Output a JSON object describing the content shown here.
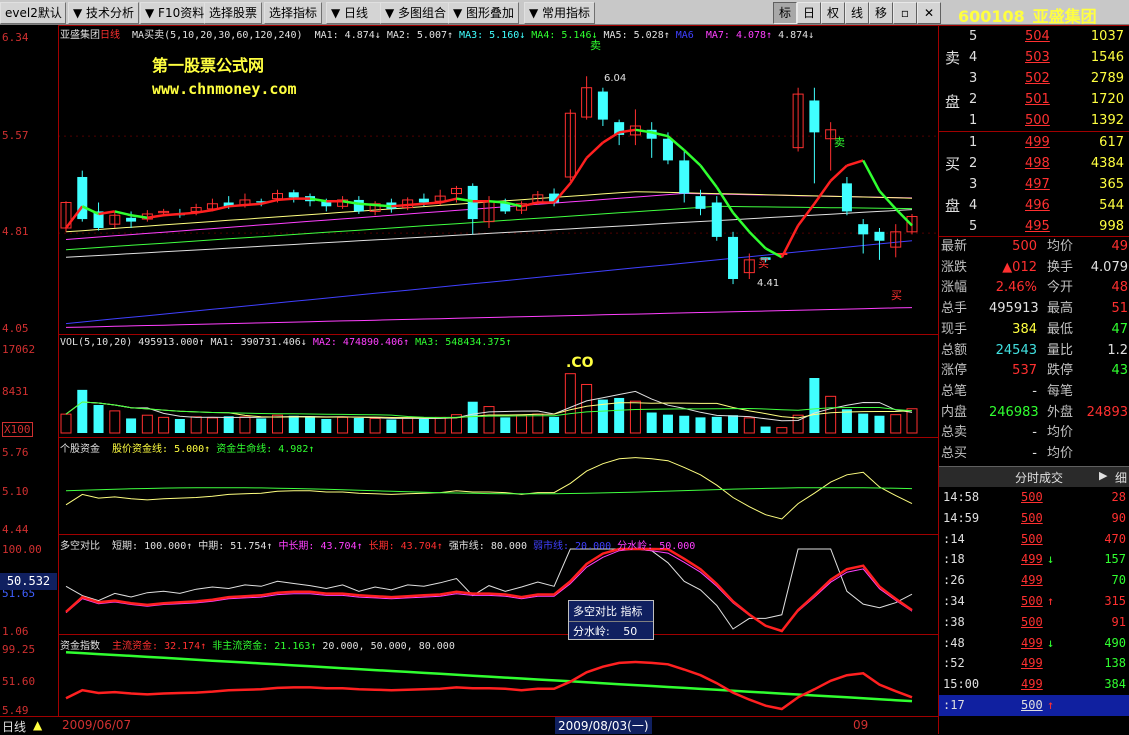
{
  "menu": {
    "items": [
      "evel2默认",
      "技术分析",
      "F10资料",
      "选择股票",
      "选择指标",
      "日线",
      "多图组合",
      "图形叠加",
      "常用指标"
    ],
    "tools": [
      "标",
      "日",
      "权",
      "线",
      "移"
    ]
  },
  "stock": {
    "code": "600108",
    "name": "亚盛集团"
  },
  "main_pane": {
    "name": "亚盛集团",
    "period": "日线",
    "indicator": "MA买卖(5,10,20,30,60,120,240)",
    "ma": [
      {
        "label": "MA1:",
        "value": "4.874↓",
        "color": "#e0e0e0"
      },
      {
        "label": "MA2:",
        "value": "5.007↑",
        "color": "#e0e0e0"
      },
      {
        "label": "MA3:",
        "value": "5.160↓",
        "color": "#40ffff"
      },
      {
        "label": "MA4:",
        "value": "5.146↓",
        "color": "#30ff30"
      },
      {
        "label": "MA5:",
        "value": "5.028↑",
        "color": "#e0e0e0"
      },
      {
        "label": "MA6",
        "value": "",
        "color": "#4040ff"
      },
      {
        "label": "MA7:",
        "value": "4.078↑",
        "color": "#ff40ff"
      },
      {
        "label": "",
        "value": "4.874↓",
        "color": "#e0e0e0"
      }
    ],
    "y_labels": [
      "6.34",
      "5.57",
      "4.81",
      "4.05"
    ],
    "watermark_cn": "第一股票公式网",
    "watermark_url": "www.chnmoney.com",
    "max_label": "6.04",
    "min_label": "4.41",
    "buy": "买",
    "sell": "卖"
  },
  "vol_pane": {
    "legend": [
      {
        "label": "VOL(5,10,20)",
        "value": "495913.000↑",
        "color": "#e0e0e0"
      },
      {
        "label": "MA1:",
        "value": "390731.406↓",
        "color": "#e0e0e0"
      },
      {
        "label": "MA2:",
        "value": "474890.406↑",
        "color": "#ff40ff"
      },
      {
        "label": "MA3:",
        "value": "548434.375↑",
        "color": "#30ff30"
      }
    ],
    "y_labels": [
      "17062",
      "8431",
      "X100"
    ],
    "co_label": ".CO"
  },
  "fund_pane": {
    "legend": [
      {
        "label": "个股资金",
        "value": "",
        "color": "#e0e0e0"
      },
      {
        "label": "股价资金线:",
        "value": "5.000↑",
        "color": "#ffff40"
      },
      {
        "label": "资金生命线:",
        "value": "4.982↑",
        "color": "#30ff30"
      }
    ],
    "y_labels": [
      "5.76",
      "5.10",
      "4.44"
    ]
  },
  "dk_pane": {
    "legend": [
      {
        "label": "多空对比",
        "value": "",
        "color": "#e0e0e0"
      },
      {
        "label": "短期:",
        "value": "100.000↑",
        "color": "#e0e0e0"
      },
      {
        "label": "中期:",
        "value": "51.754↑",
        "color": "#e0e0e0"
      },
      {
        "label": "中长期:",
        "value": "43.704↑",
        "color": "#ff40ff"
      },
      {
        "label": "长期:",
        "value": "43.704↑",
        "color": "#ff3030"
      },
      {
        "label": "强市线:",
        "value": "80.000",
        "color": "#e0e0e0"
      },
      {
        "label": "弱市线:",
        "value": "20.000",
        "color": "#4040ff"
      },
      {
        "label": "分水岭:",
        "value": "50.000",
        "color": "#ff40ff"
      }
    ],
    "y_labels": [
      "100.00",
      "51.65",
      "1.06"
    ],
    "cursor_value": "50.532",
    "tooltip_title": "多空对比 指标",
    "tooltip_label": "分水岭:",
    "tooltip_value": "50"
  },
  "zj_pane": {
    "legend": [
      {
        "label": "资金指数",
        "value": "",
        "color": "#e0e0e0"
      },
      {
        "label": "主流资金:",
        "value": "32.174↑",
        "color": "#ff3030"
      },
      {
        "label": "非主流资金:",
        "value": "21.163↑",
        "color": "#30ff30"
      },
      {
        "label": "",
        "value": "20.000,",
        "color": "#e0e0e0"
      },
      {
        "label": "",
        "value": "50.000,",
        "color": "#e0e0e0"
      },
      {
        "label": "",
        "value": "80.000",
        "color": "#e0e0e0"
      }
    ],
    "y_labels": [
      "99.25",
      "51.60",
      "5.49"
    ]
  },
  "bottom": {
    "period": "日线",
    "date_left": "2009/06/07",
    "date_mid": "2009/08/03(一)",
    "date_right": "09"
  },
  "orderbook": {
    "sell_label": [
      "卖",
      "盘"
    ],
    "buy_label": [
      "买",
      "盘"
    ],
    "sell": [
      {
        "level": "5",
        "price": "504",
        "vol": "1037"
      },
      {
        "level": "4",
        "price": "503",
        "vol": "1546"
      },
      {
        "level": "3",
        "price": "502",
        "vol": "2789"
      },
      {
        "level": "2",
        "price": "501",
        "vol": "1720"
      },
      {
        "level": "1",
        "price": "500",
        "vol": "1392"
      }
    ],
    "buy": [
      {
        "level": "1",
        "price": "499",
        "vol": "617"
      },
      {
        "level": "2",
        "price": "498",
        "vol": "4384"
      },
      {
        "level": "3",
        "price": "497",
        "vol": "365"
      },
      {
        "level": "4",
        "price": "496",
        "vol": "544"
      },
      {
        "level": "5",
        "price": "495",
        "vol": "998"
      }
    ]
  },
  "quote": [
    {
      "l1": "最新",
      "v1": "500",
      "c1": "red",
      "l2": "均价",
      "v2": "49",
      "c2": "red"
    },
    {
      "l1": "涨跌",
      "v1": "▲012",
      "c1": "red",
      "l2": "换手",
      "v2": "4.079",
      "c2": "white"
    },
    {
      "l1": "涨幅",
      "v1": "2.46%",
      "c1": "red",
      "l2": "今开",
      "v2": "48",
      "c2": "red"
    },
    {
      "l1": "总手",
      "v1": "495913",
      "c1": "white",
      "l2": "最高",
      "v2": "51",
      "c2": "red"
    },
    {
      "l1": "现手",
      "v1": "384",
      "c1": "yellow",
      "l2": "最低",
      "v2": "47",
      "c2": "green"
    },
    {
      "l1": "总额",
      "v1": "24543",
      "c1": "cyan",
      "l2": "量比",
      "v2": "1.2",
      "c2": "white"
    },
    {
      "l1": "涨停",
      "v1": "537",
      "c1": "red",
      "l2": "跌停",
      "v2": "43",
      "c2": "green"
    },
    {
      "l1": "总笔",
      "v1": "-",
      "c1": "white",
      "l2": "每笔",
      "v2": "",
      "c2": "white"
    },
    {
      "l1": "内盘",
      "v1": "246983",
      "c1": "green",
      "l2": "外盘",
      "v2": "24893",
      "c2": "red"
    },
    {
      "l1": "总卖",
      "v1": "-",
      "c1": "white",
      "l2": "均价",
      "v2": "",
      "c2": "white"
    },
    {
      "l1": "总买",
      "v1": "-",
      "c1": "white",
      "l2": "均价",
      "v2": "",
      "c2": "white"
    }
  ],
  "ticks_header": {
    "label": "分时成交",
    "tab": "细"
  },
  "ticks": [
    {
      "time": "14:58",
      "price": "500",
      "arrow": "",
      "vol": "28",
      "pc": "red",
      "vc": "red"
    },
    {
      "time": "14:59",
      "price": "500",
      "arrow": "",
      "vol": "90",
      "pc": "red",
      "vc": "red"
    },
    {
      "time": ":14",
      "price": "500",
      "arrow": "",
      "vol": "470",
      "pc": "red",
      "vc": "red"
    },
    {
      "time": ":18",
      "price": "499",
      "arrow": "↓",
      "vol": "157",
      "pc": "red",
      "vc": "green"
    },
    {
      "time": ":26",
      "price": "499",
      "arrow": "",
      "vol": "70",
      "pc": "red",
      "vc": "green"
    },
    {
      "time": ":34",
      "price": "500",
      "arrow": "↑",
      "vol": "315",
      "pc": "red",
      "vc": "red"
    },
    {
      "time": ":38",
      "price": "500",
      "arrow": "",
      "vol": "91",
      "pc": "red",
      "vc": "red"
    },
    {
      "time": ":48",
      "price": "499",
      "arrow": "↓",
      "vol": "490",
      "pc": "red",
      "vc": "green"
    },
    {
      "time": ":52",
      "price": "499",
      "arrow": "",
      "vol": "138",
      "pc": "red",
      "vc": "green"
    },
    {
      "time": "15:00",
      "price": "499",
      "arrow": "",
      "vol": "384",
      "pc": "red",
      "vc": "green"
    },
    {
      "time": ":17",
      "price": "500",
      "arrow": "↑",
      "vol": "",
      "pc": "white",
      "vc": "white"
    }
  ],
  "chart_data": {
    "type": "line",
    "candles": [
      [
        4.85,
        5.05,
        4.82,
        5.06
      ],
      [
        5.25,
        4.92,
        4.9,
        5.3
      ],
      [
        4.98,
        4.85,
        4.83,
        5.05
      ],
      [
        4.88,
        4.95,
        4.85,
        4.98
      ],
      [
        4.93,
        4.9,
        4.85,
        4.98
      ],
      [
        4.92,
        4.96,
        4.9,
        4.99
      ],
      [
        4.97,
        4.98,
        4.94,
        5.0
      ],
      [
        4.96,
        4.95,
        4.93,
        5.0
      ],
      [
        4.98,
        5.01,
        4.95,
        5.04
      ],
      [
        5.0,
        5.04,
        4.98,
        5.08
      ],
      [
        5.05,
        5.02,
        5.0,
        5.1
      ],
      [
        5.03,
        5.07,
        5.01,
        5.12
      ],
      [
        5.06,
        5.05,
        5.02,
        5.08
      ],
      [
        5.08,
        5.12,
        5.05,
        5.15
      ],
      [
        5.13,
        5.09,
        5.05,
        5.15
      ],
      [
        5.1,
        5.06,
        5.02,
        5.12
      ],
      [
        5.06,
        5.02,
        4.98,
        5.08
      ],
      [
        5.02,
        5.07,
        5.0,
        5.1
      ],
      [
        5.07,
        4.98,
        4.96,
        5.1
      ],
      [
        4.98,
        5.04,
        4.95,
        5.06
      ],
      [
        5.05,
        5.0,
        4.97,
        5.08
      ],
      [
        5.01,
        5.07,
        4.99,
        5.09
      ],
      [
        5.08,
        5.05,
        5.02,
        5.12
      ],
      [
        5.06,
        5.1,
        5.03,
        5.15
      ],
      [
        5.12,
        5.16,
        5.05,
        5.18
      ],
      [
        5.18,
        4.92,
        4.8,
        5.2
      ],
      [
        4.9,
        5.06,
        4.85,
        5.1
      ],
      [
        5.05,
        4.98,
        4.96,
        5.08
      ],
      [
        4.99,
        5.04,
        4.96,
        5.06
      ],
      [
        5.05,
        5.11,
        5.03,
        5.14
      ],
      [
        5.12,
        5.05,
        5.02,
        5.16
      ],
      [
        5.25,
        5.75,
        5.22,
        5.78
      ],
      [
        5.72,
        5.95,
        5.7,
        6.04
      ],
      [
        5.92,
        5.7,
        5.65,
        5.95
      ],
      [
        5.68,
        5.58,
        5.5,
        5.7
      ],
      [
        5.58,
        5.65,
        5.5,
        5.78
      ],
      [
        5.62,
        5.55,
        5.4,
        5.68
      ],
      [
        5.55,
        5.38,
        5.35,
        5.6
      ],
      [
        5.38,
        5.12,
        5.05,
        5.45
      ],
      [
        5.1,
        5.0,
        4.95,
        5.15
      ],
      [
        5.05,
        4.78,
        4.75,
        5.1
      ],
      [
        4.78,
        4.45,
        4.41,
        4.82
      ],
      [
        4.5,
        4.6,
        4.45,
        4.65
      ],
      [
        4.62,
        4.6,
        4.58,
        4.62
      ],
      [
        4.65,
        4.65,
        4.65,
        4.65
      ],
      [
        5.48,
        5.9,
        5.45,
        5.95
      ],
      [
        5.85,
        5.6,
        5.2,
        5.95
      ],
      [
        5.55,
        5.62,
        5.3,
        5.68
      ],
      [
        5.2,
        4.98,
        4.95,
        5.25
      ],
      [
        4.88,
        4.8,
        4.65,
        4.92
      ],
      [
        4.82,
        4.75,
        4.6,
        4.85
      ],
      [
        4.7,
        4.82,
        4.62,
        4.88
      ],
      [
        4.82,
        4.94,
        4.8,
        4.96
      ]
    ],
    "ma1": [
      4.85,
      5.02,
      4.96,
      4.98,
      4.95,
      4.93,
      4.95,
      4.96,
      4.97,
      4.99,
      5.02,
      5.03,
      5.04,
      5.07,
      5.08,
      5.08,
      5.06,
      5.06,
      5.04,
      5.03,
      5.02,
      5.03,
      5.04,
      5.05,
      5.08,
      5.06,
      5.06,
      5.05,
      5.02,
      5.05,
      5.05,
      5.2,
      5.4,
      5.52,
      5.6,
      5.62,
      5.6,
      5.57,
      5.46,
      5.34,
      5.17,
      4.97,
      4.82,
      4.69,
      4.62,
      4.87,
      5.04,
      5.22,
      5.34,
      5.38,
      5.14,
      5.0,
      4.87
    ],
    "vol": [
      3500,
      8000,
      5200,
      4100,
      2700,
      3300,
      2900,
      2600,
      3000,
      2800,
      3100,
      3000,
      2700,
      3300,
      3200,
      3100,
      2600,
      2900,
      2800,
      2700,
      2500,
      2800,
      2600,
      2900,
      3400,
      5800,
      4900,
      2900,
      3300,
      3500,
      3000,
      11000,
      9000,
      6200,
      6500,
      5900,
      3800,
      3400,
      3200,
      2900,
      3000,
      3300,
      2800,
      1200,
      1000,
      3300,
      10200,
      6800,
      4400,
      3600,
      3200,
      3400,
      4495
    ]
  }
}
